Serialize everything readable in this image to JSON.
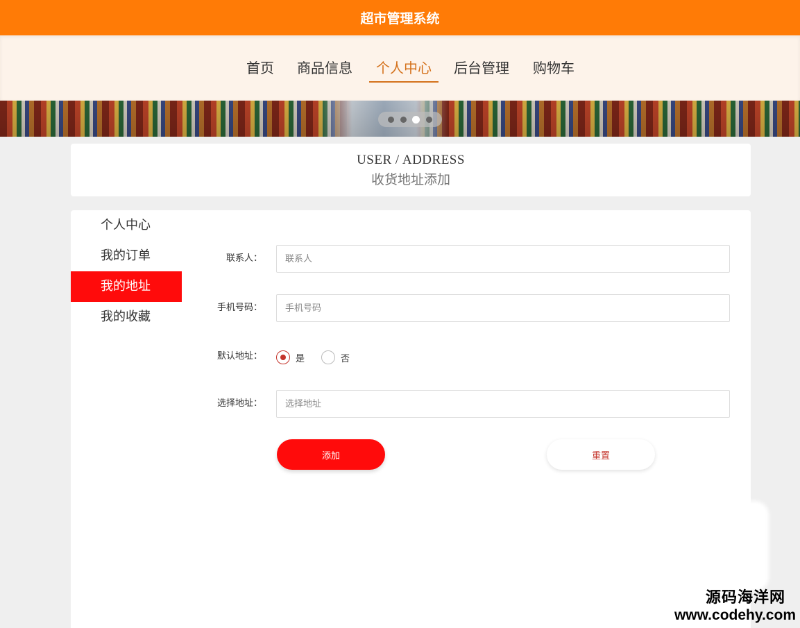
{
  "header": {
    "title": "超市管理系统"
  },
  "nav": {
    "items": [
      {
        "label": "首页"
      },
      {
        "label": "商品信息"
      },
      {
        "label": "个人中心",
        "active": true
      },
      {
        "label": "后台管理"
      },
      {
        "label": "购物车"
      }
    ]
  },
  "banner": {
    "slide_count": 4,
    "active_slide": 3
  },
  "page_heading": {
    "en": "USER / ADDRESS",
    "cn": "收货地址添加"
  },
  "sidebar": {
    "items": [
      {
        "label": "个人中心"
      },
      {
        "label": "我的订单"
      },
      {
        "label": "我的地址",
        "active": true
      },
      {
        "label": "我的收藏"
      }
    ]
  },
  "form": {
    "contact": {
      "label": "联系人：",
      "placeholder": "联系人",
      "value": ""
    },
    "phone": {
      "label": "手机号码：",
      "placeholder": "手机号码",
      "value": ""
    },
    "default_address": {
      "label": "默认地址：",
      "options": [
        {
          "label": "是",
          "checked": true
        },
        {
          "label": "否",
          "checked": false
        }
      ]
    },
    "address": {
      "label": "选择地址：",
      "placeholder": "选择地址",
      "value": ""
    },
    "submit_label": "添加",
    "reset_label": "重置"
  },
  "watermark": {
    "line1": "源码海洋网",
    "line2": "www.codehy.com"
  },
  "colors": {
    "brand_orange": "#ff7b06",
    "nav_bg": "#fdf3ea",
    "active_nav": "#d4711b",
    "accent_red": "#ff0b0b",
    "radio_red": "#c4342b"
  }
}
